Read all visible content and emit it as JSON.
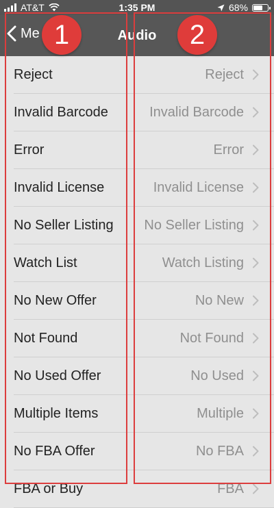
{
  "status_bar": {
    "carrier": "AT&T",
    "time": "1:35 PM",
    "battery_percent": "68%",
    "battery_level": 0.68,
    "icons": [
      "signal-icon",
      "wifi-icon",
      "location-arrow-icon",
      "battery-icon"
    ]
  },
  "nav": {
    "back_label": "Me",
    "title": "Audio"
  },
  "rows": [
    {
      "label": "Reject",
      "value": "Reject"
    },
    {
      "label": "Invalid Barcode",
      "value": "Invalid Barcode"
    },
    {
      "label": "Error",
      "value": "Error"
    },
    {
      "label": "Invalid License",
      "value": "Invalid License"
    },
    {
      "label": "No Seller Listing",
      "value": "No Seller Listing"
    },
    {
      "label": "Watch List",
      "value": "Watch Listing"
    },
    {
      "label": "No New Offer",
      "value": "No New"
    },
    {
      "label": "Not Found",
      "value": "Not Found"
    },
    {
      "label": "No Used Offer",
      "value": "No Used"
    },
    {
      "label": "Multiple Items",
      "value": "Multiple"
    },
    {
      "label": "No FBA Offer",
      "value": "No FBA"
    },
    {
      "label": "FBA or Buy",
      "value": "FBA"
    }
  ],
  "annotations": {
    "badge_1": "1",
    "badge_2": "2"
  },
  "colors": {
    "nav_background": "#575757",
    "list_background": "#e6e6e6",
    "annotation_red": "#dc3d3d",
    "value_text": "#8f8f8f"
  }
}
